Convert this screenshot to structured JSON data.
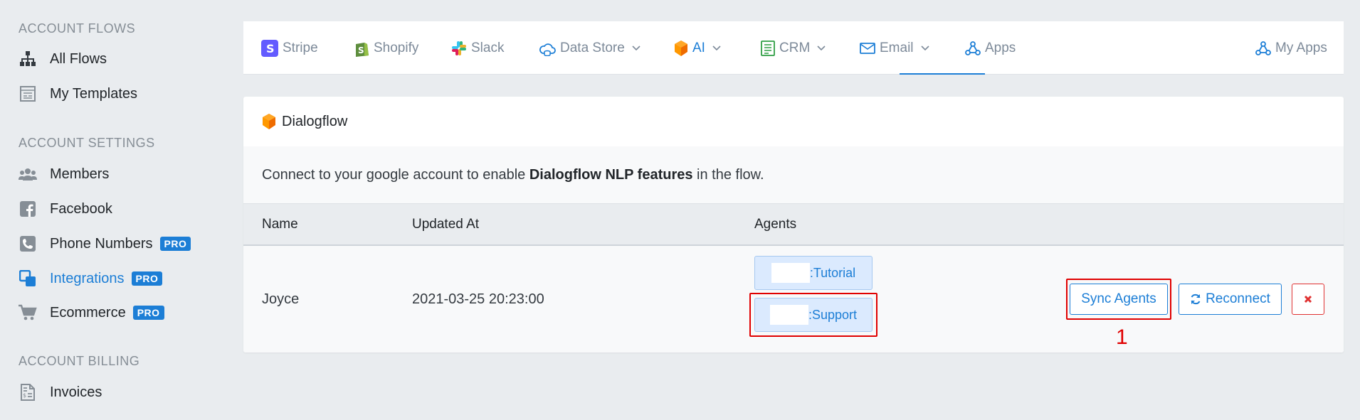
{
  "sidebar": {
    "sections": [
      {
        "label": "ACCOUNT FLOWS"
      },
      {
        "label": "ACCOUNT SETTINGS"
      },
      {
        "label": "ACCOUNT BILLING"
      }
    ],
    "items": [
      {
        "label": "All Flows",
        "icon": "sitemap-icon"
      },
      {
        "label": "My Templates",
        "icon": "template-icon"
      },
      {
        "label": "Members",
        "icon": "users-icon"
      },
      {
        "label": "Facebook",
        "icon": "facebook-icon"
      },
      {
        "label": "Phone Numbers",
        "icon": "phone-icon",
        "badge": "PRO"
      },
      {
        "label": "Integrations",
        "icon": "integrations-icon",
        "badge": "PRO",
        "active": true
      },
      {
        "label": "Ecommerce",
        "icon": "cart-icon",
        "badge": "PRO"
      },
      {
        "label": "Invoices",
        "icon": "invoice-icon"
      }
    ]
  },
  "topnav": {
    "tabs": [
      {
        "label": "Stripe",
        "icon": "stripe-icon"
      },
      {
        "label": "Shopify",
        "icon": "shopify-icon"
      },
      {
        "label": "Slack",
        "icon": "slack-icon"
      },
      {
        "label": "Data Store",
        "icon": "database-cloud-icon",
        "dropdown": true
      },
      {
        "label": "AI",
        "icon": "dialogflow-icon",
        "dropdown": true,
        "active": true
      },
      {
        "label": "CRM",
        "icon": "crm-icon",
        "dropdown": true
      },
      {
        "label": "Email",
        "icon": "envelope-icon",
        "dropdown": true
      },
      {
        "label": "Apps",
        "icon": "webhook-icon"
      }
    ],
    "my_apps": "My Apps"
  },
  "card": {
    "title": "Dialogflow",
    "desc_prefix": "Connect to your google account to enable ",
    "desc_bold": "Dialogflow NLP features",
    "desc_suffix": " in the flow.",
    "columns": [
      "Name",
      "Updated At",
      "Agents"
    ],
    "row": {
      "name": "Joyce",
      "updated_at": "2021-03-25 20:23:00",
      "agents": [
        ":Tutorial",
        ":Support"
      ]
    },
    "actions": {
      "sync": "Sync Agents",
      "reconnect": "Reconnect"
    }
  },
  "annotation": {
    "number": "1"
  },
  "colors": {
    "accent": "#1c7ed6",
    "danger": "#e03131",
    "highlight": "#e00000",
    "dialogflow": "#ff8f00"
  }
}
